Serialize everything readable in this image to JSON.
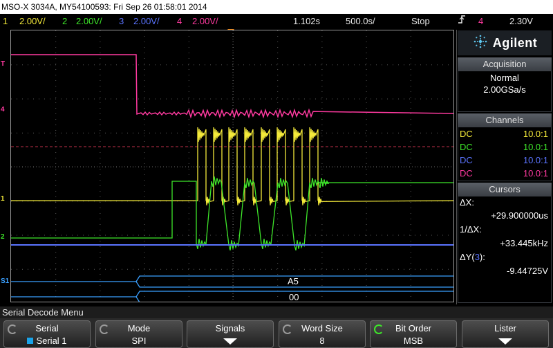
{
  "title": "MSO-X 3034A, MY54100593: Fri Sep 26 01:58:01 2014",
  "status": {
    "ch1_num": "1",
    "ch1_scale": "2.00V/",
    "ch2_num": "2",
    "ch2_scale": "2.00V/",
    "ch3_num": "3",
    "ch3_scale": "2.00V/",
    "ch4_num": "4",
    "ch4_scale": "2.00V/",
    "delay": "1.102s",
    "timebase": "500.0s/",
    "run_state": "Stop",
    "trigger_icon": "trigger-edge-icon",
    "trigger_source": "4",
    "trigger_level": "2.30V"
  },
  "left_markers": {
    "trigger": "T",
    "ch4": "4",
    "ch1": "1",
    "ch2": "2",
    "serial": "S1"
  },
  "serial_bus": {
    "row1_value": "A5",
    "row2_value": "00"
  },
  "logo": {
    "text": "Agilent",
    "icon": "agilent-spark-icon"
  },
  "acquisition": {
    "header": "Acquisition",
    "mode": "Normal",
    "rate": "2.00GSa/s"
  },
  "channels": {
    "header": "Channels",
    "rows": [
      {
        "coupling": "DC",
        "probe": "10.0:1",
        "color": "#f4ea3a"
      },
      {
        "coupling": "DC",
        "probe": "10.0:1",
        "color": "#3ee62a"
      },
      {
        "coupling": "DC",
        "probe": "10.0:1",
        "color": "#5b74ff"
      },
      {
        "coupling": "DC",
        "probe": "10.0:1",
        "color": "#ff3aa0"
      }
    ]
  },
  "cursors": {
    "header": "Cursors",
    "dx_label": "ΔX:",
    "dx_value": "+29.900000us",
    "inv_dx_label": "1/ΔX:",
    "inv_dx_value": "+33.445kHz",
    "dy_label_pre": "ΔY(",
    "dy_label_ch": "3",
    "dy_label_post": "):",
    "dy_value": "-9.44725V"
  },
  "menu": {
    "title": "Serial Decode Menu"
  },
  "softkeys": {
    "serial_label": "Serial",
    "serial_value": "Serial 1",
    "mode_label": "Mode",
    "mode_value": "SPI",
    "signals_label": "Signals",
    "word_size_label": "Word Size",
    "word_size_value": "8",
    "bit_order_label": "Bit Order",
    "bit_order_value": "MSB",
    "lister_label": "Lister"
  },
  "colors": {
    "ch1": "#f4ea3a",
    "ch2": "#3ee62a",
    "ch3": "#5b74ff",
    "ch4": "#ff3aa0",
    "trigger_marker": "#f08a1a",
    "serial_bus": "#3aa0ff",
    "grid": "#5a5a5a"
  }
}
